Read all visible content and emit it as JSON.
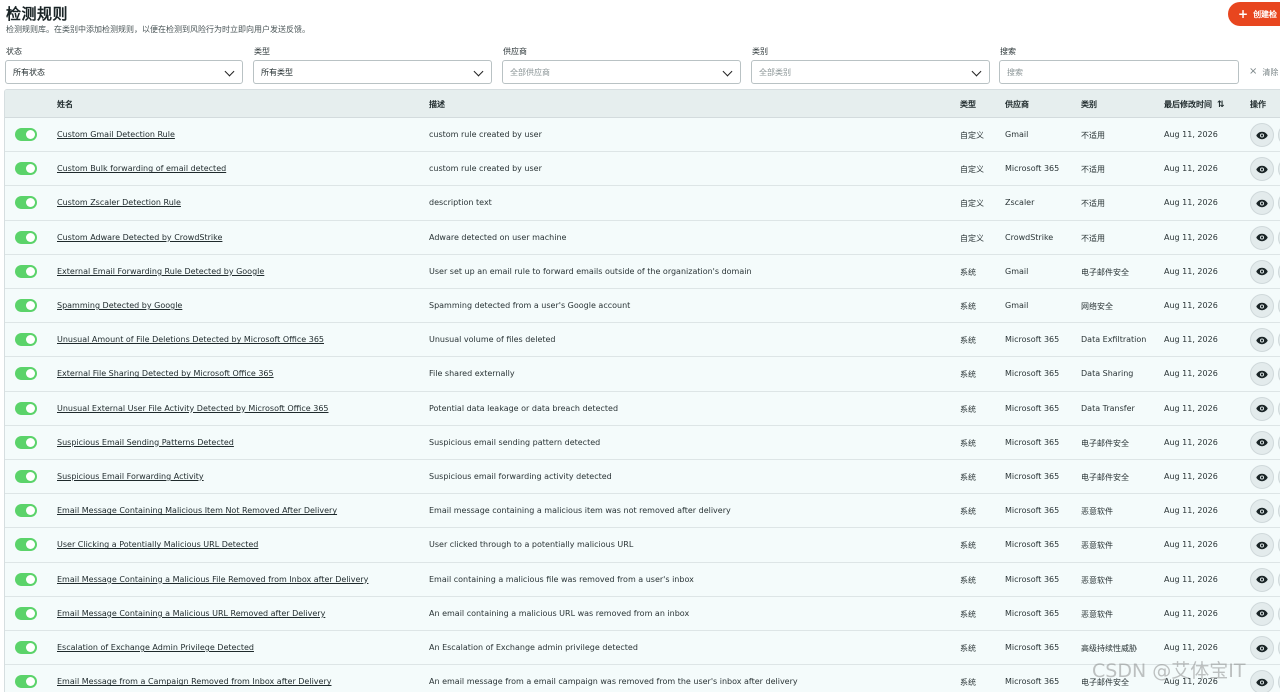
{
  "header": {
    "title": "检测规则",
    "description": "检测规则库。在类别中添加检测规则，以便在检测到风险行为时立即向用户发送反馈。",
    "create_label": "创建检"
  },
  "filters": {
    "status": {
      "label": "状态",
      "value": "所有状态"
    },
    "type": {
      "label": "类型",
      "value": "所有类型"
    },
    "vendor": {
      "label": "供应商",
      "value": "全部供应商"
    },
    "category": {
      "label": "类别",
      "value": "全部类别"
    },
    "search": {
      "label": "搜索",
      "placeholder": "搜索"
    },
    "clear_label": "清除"
  },
  "table": {
    "columns": {
      "name": "姓名",
      "description": "描述",
      "type": "类型",
      "vendor": "供应商",
      "category": "类别",
      "modified": "最后修改时间",
      "actions": "操作"
    },
    "rows": [
      {
        "name": "Custom Gmail Detection Rule",
        "description": "custom rule created by user",
        "type": "自定义",
        "vendor": "Gmail",
        "category": "不适用",
        "modified": "Aug 11, 2026"
      },
      {
        "name": "Custom Bulk forwarding of email detected",
        "description": "custom rule created by user",
        "type": "自定义",
        "vendor": "Microsoft 365",
        "category": "不适用",
        "modified": "Aug 11, 2026"
      },
      {
        "name": "Custom Zscaler Detection Rule",
        "description": "description text",
        "type": "自定义",
        "vendor": "Zscaler",
        "category": "不适用",
        "modified": "Aug 11, 2026"
      },
      {
        "name": "Custom Adware Detected by CrowdStrike",
        "description": "Adware detected on user machine",
        "type": "自定义",
        "vendor": "CrowdStrike",
        "category": "不适用",
        "modified": "Aug 11, 2026"
      },
      {
        "name": "External Email Forwarding Rule Detected by Google",
        "description": "User set up an email rule to forward emails outside of the organization's domain",
        "type": "系统",
        "vendor": "Gmail",
        "category": "电子邮件安全",
        "modified": "Aug 11, 2026"
      },
      {
        "name": "Spamming Detected by Google",
        "description": "Spamming detected from a user's Google account",
        "type": "系统",
        "vendor": "Gmail",
        "category": "网络安全",
        "modified": "Aug 11, 2026"
      },
      {
        "name": "Unusual Amount of File Deletions Detected by Microsoft Office 365",
        "description": "Unusual volume of files deleted",
        "type": "系统",
        "vendor": "Microsoft 365",
        "category": "Data Exfiltration",
        "modified": "Aug 11, 2026"
      },
      {
        "name": "External File Sharing Detected by Microsoft Office 365",
        "description": "File shared externally",
        "type": "系统",
        "vendor": "Microsoft 365",
        "category": "Data Sharing",
        "modified": "Aug 11, 2026"
      },
      {
        "name": "Unusual External User File Activity Detected by Microsoft Office 365",
        "description": "Potential data leakage or data breach detected",
        "type": "系统",
        "vendor": "Microsoft 365",
        "category": "Data Transfer",
        "modified": "Aug 11, 2026"
      },
      {
        "name": "Suspicious Email Sending Patterns Detected",
        "description": "Suspicious email sending pattern detected",
        "type": "系统",
        "vendor": "Microsoft 365",
        "category": "电子邮件安全",
        "modified": "Aug 11, 2026"
      },
      {
        "name": "Suspicious Email Forwarding Activity",
        "description": "Suspicious email forwarding activity detected",
        "type": "系统",
        "vendor": "Microsoft 365",
        "category": "电子邮件安全",
        "modified": "Aug 11, 2026"
      },
      {
        "name": "Email Message Containing Malicious Item Not Removed After Delivery",
        "description": "Email message containing a malicious item was not removed after delivery",
        "type": "系统",
        "vendor": "Microsoft 365",
        "category": "恶意软件",
        "modified": "Aug 11, 2026"
      },
      {
        "name": "User Clicking a Potentially Malicious URL Detected",
        "description": "User clicked through to a potentially malicious URL",
        "type": "系统",
        "vendor": "Microsoft 365",
        "category": "恶意软件",
        "modified": "Aug 11, 2026"
      },
      {
        "name": "Email Message Containing a Malicious File Removed from Inbox after Delivery",
        "description": "Email containing a malicious file was removed from a user's inbox",
        "type": "系统",
        "vendor": "Microsoft 365",
        "category": "恶意软件",
        "modified": "Aug 11, 2026"
      },
      {
        "name": "Email Message Containing a Malicious URL Removed after Delivery",
        "description": "An email containing a malicious URL was removed from an inbox",
        "type": "系统",
        "vendor": "Microsoft 365",
        "category": "恶意软件",
        "modified": "Aug 11, 2026"
      },
      {
        "name": "Escalation of Exchange Admin Privilege Detected",
        "description": "An Escalation of Exchange admin privilege detected",
        "type": "系统",
        "vendor": "Microsoft 365",
        "category": "高级持续性威胁",
        "modified": "Aug 11, 2026"
      },
      {
        "name": "Email Message from a Campaign Removed from Inbox after Delivery",
        "description": "An email message from a email campaign was removed from the user's inbox after delivery",
        "type": "系统",
        "vendor": "Microsoft 365",
        "category": "电子邮件安全",
        "modified": "Aug 11, 2026"
      }
    ]
  },
  "watermark": "CSDN @艾体宝IT",
  "colors": {
    "accent": "#e8461f",
    "toggle_on": "#5bd36a",
    "row_bg": "#f4fbfb",
    "header_bg": "#e6eeee"
  }
}
